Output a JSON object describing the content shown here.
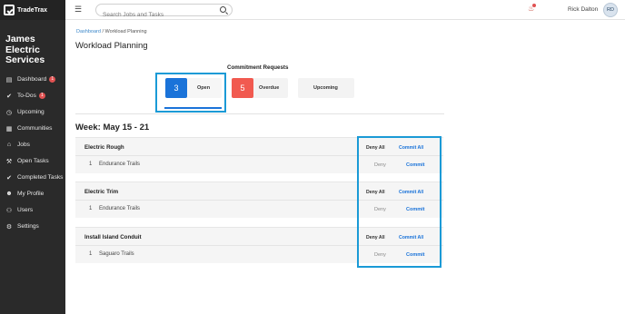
{
  "app": {
    "brand": "TradeTrax",
    "company": "James Electric Services"
  },
  "sidebar": {
    "items": [
      {
        "label": "Dashboard",
        "icon": "calendar-icon",
        "badge": "1"
      },
      {
        "label": "To-Dos",
        "icon": "check-circle-icon",
        "badge": "1"
      },
      {
        "label": "Upcoming",
        "icon": "clock-icon"
      },
      {
        "label": "Communities",
        "icon": "building-icon"
      },
      {
        "label": "Jobs",
        "icon": "home-icon"
      },
      {
        "label": "Open Tasks",
        "icon": "wrench-icon"
      },
      {
        "label": "Completed Tasks",
        "icon": "check-circle-icon"
      },
      {
        "label": "My Profile",
        "icon": "user-circle-icon"
      },
      {
        "label": "Users",
        "icon": "users-icon"
      },
      {
        "label": "Settings",
        "icon": "gear-icon"
      }
    ]
  },
  "header": {
    "search_placeholder": "Search Jobs and Tasks",
    "user_name": "Rick Dalton",
    "avatar_initials": "RD"
  },
  "breadcrumb": {
    "root": "Dashboard",
    "separator": "/",
    "current": "Workload Planning"
  },
  "page": {
    "title": "Workload Planning"
  },
  "commitment": {
    "heading": "Commitment Requests",
    "cards": [
      {
        "count": "3",
        "label": "Open",
        "color": "#1a73d9"
      },
      {
        "count": "5",
        "label": "Overdue",
        "color": "#f15a50"
      },
      {
        "label": "Upcoming"
      }
    ]
  },
  "week": {
    "title": "Week: May 15 - 21"
  },
  "actions": {
    "deny_all": "Deny All",
    "commit_all": "Commit All",
    "deny": "Deny",
    "commit": "Commit"
  },
  "jobs": [
    {
      "title": "Electric Rough",
      "rows": [
        {
          "qty": "1",
          "community": "Endurance Trails"
        }
      ]
    },
    {
      "title": "Electric Trim",
      "rows": [
        {
          "qty": "1",
          "community": "Endurance Trails"
        }
      ]
    },
    {
      "title": "Install Island Conduit",
      "rows": [
        {
          "qty": "1",
          "community": "Saguaro Trails"
        }
      ]
    }
  ],
  "colors": {
    "sidebar": "#2a2a2a",
    "accent": "#1a73d9",
    "highlight": "#1a9ad6",
    "alert": "#f15a50"
  }
}
